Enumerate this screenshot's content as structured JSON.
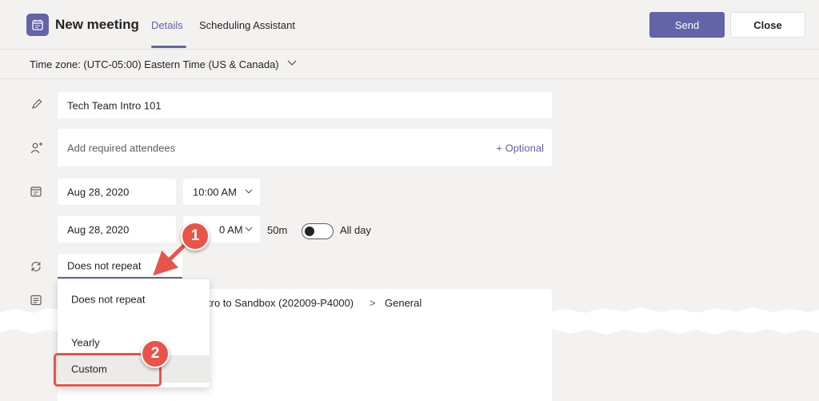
{
  "header": {
    "title": "New meeting",
    "tabs": [
      {
        "label": "Details"
      },
      {
        "label": "Scheduling Assistant"
      }
    ],
    "send_label": "Send",
    "close_label": "Close"
  },
  "timezone": {
    "label": "Time zone: (UTC-05:00) Eastern Time (US & Canada)"
  },
  "form": {
    "title_value": "Tech Team Intro 101",
    "attendees_placeholder": "Add required attendees",
    "optional_label": "+ Optional",
    "start_date": "Aug 28, 2020",
    "start_time": "10:00 AM",
    "end_date": "Aug 28, 2020",
    "end_time_visible": "0 AM",
    "duration": "50m",
    "all_day_label": "All day",
    "all_day_enabled": false,
    "repeat_value": "Does not repeat",
    "channel_visible": "tro to Sandbox (202009-P4000)",
    "channel_separator": ">",
    "channel_name": "General"
  },
  "repeat_dropdown": {
    "options": [
      "Does not repeat",
      "Yearly",
      "Custom"
    ],
    "highlighted": "Custom"
  },
  "annotations": [
    {
      "number": "1",
      "target": "repeat_value"
    },
    {
      "number": "2",
      "target": "Custom"
    }
  ],
  "colors": {
    "accent": "#6264a7",
    "callout": "#e8544a",
    "background": "#f3f2f1"
  }
}
